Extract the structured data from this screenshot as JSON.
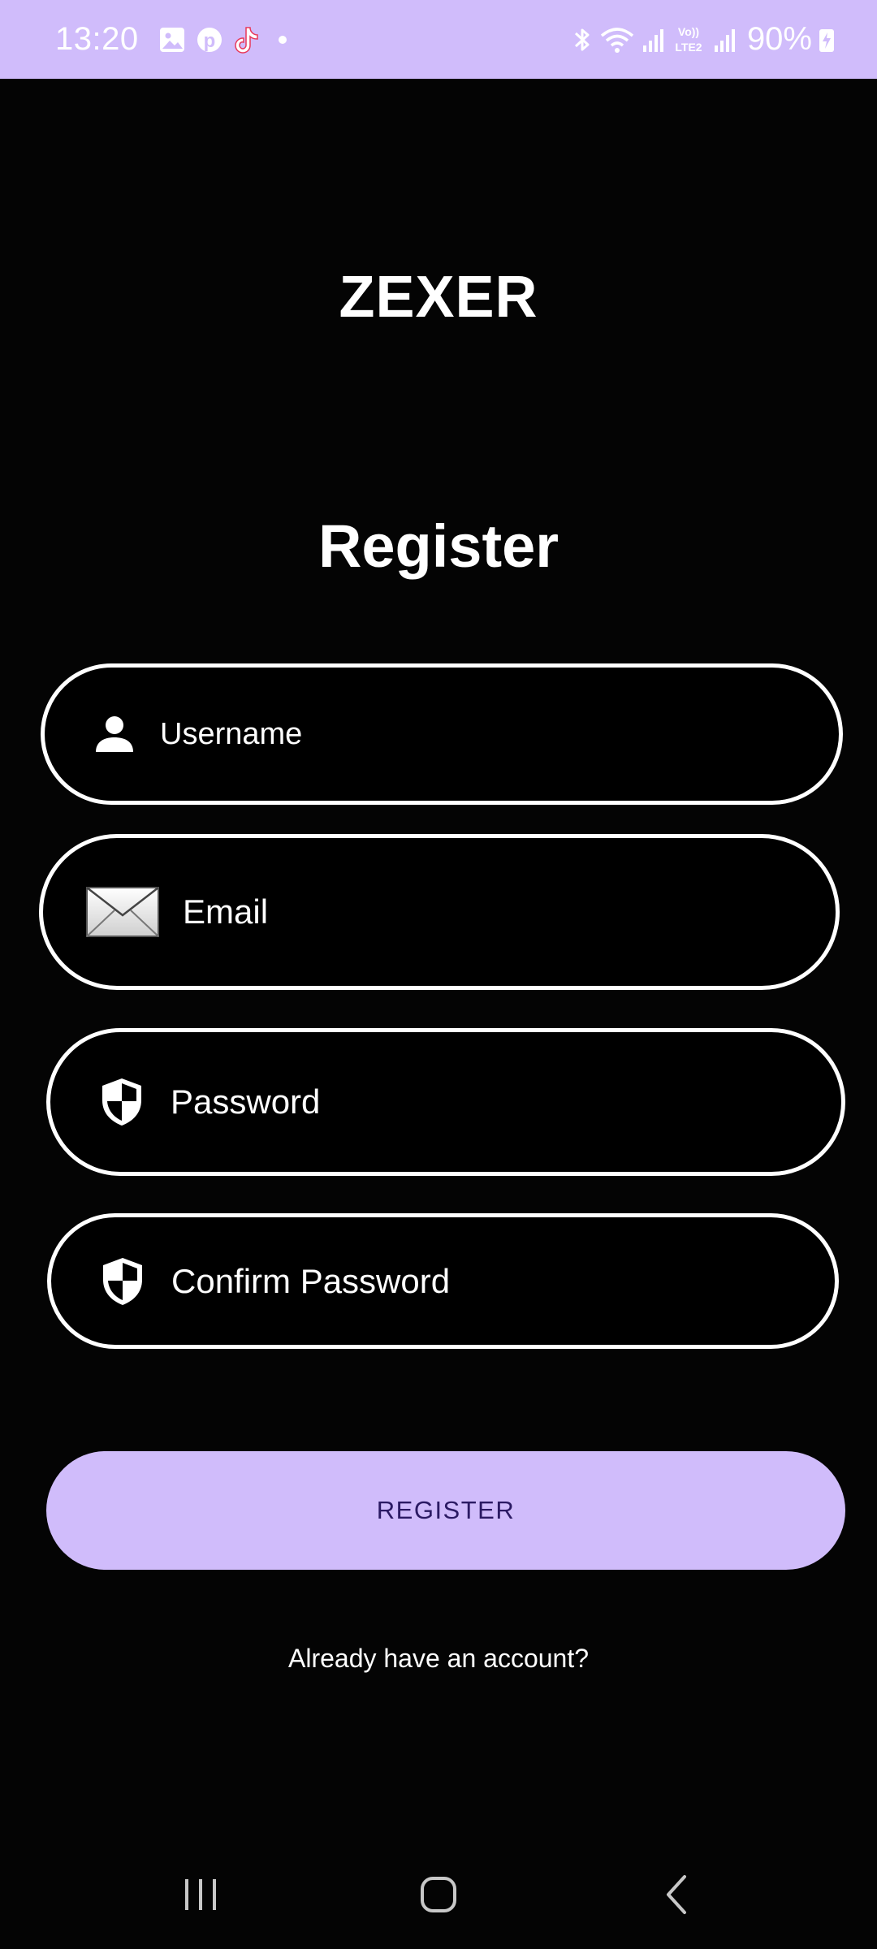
{
  "status_bar": {
    "time": "13:20",
    "battery_percent": "90%",
    "notification_icons": [
      "gallery-icon",
      "pinterest-icon",
      "tiktok-icon",
      "dot-icon"
    ],
    "system_icons": [
      "bluetooth-icon",
      "wifi-icon",
      "signal-icon",
      "volte-lte2-icon",
      "signal-icon",
      "battery-charging-icon"
    ]
  },
  "app": {
    "title": "ZEXER"
  },
  "form": {
    "title": "Register",
    "username_placeholder": "Username",
    "email_placeholder": "Email",
    "password_placeholder": "Password",
    "confirm_password_placeholder": "Confirm Password",
    "register_label": "REGISTER",
    "login_prompt": "Already have an account?"
  },
  "colors": {
    "accent": "#d0bcfb",
    "button_text": "#2b1a63",
    "background": "#040404",
    "field_border": "#ffffff"
  },
  "nav_bar": {
    "buttons": [
      "recents-icon",
      "home-icon",
      "back-icon"
    ]
  }
}
